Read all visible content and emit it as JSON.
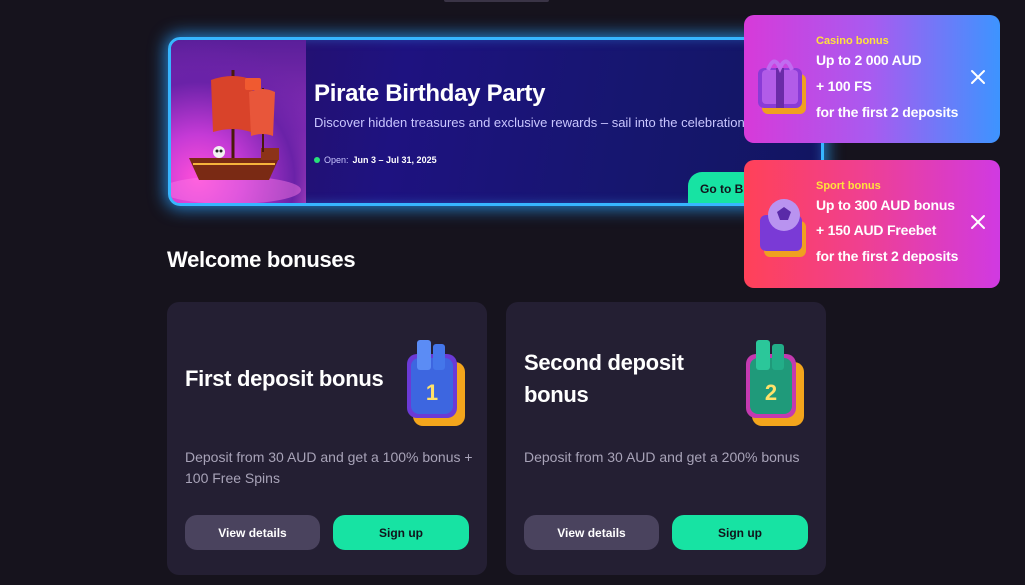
{
  "promo": {
    "title": "Pirate Birthday Party",
    "description": "Discover hidden treasures and exclusive rewards – sail into the celebration!",
    "open_label": "Open:",
    "dates": "Jun 3 – Jul 31, 2025",
    "cta_label": "Go to Birt"
  },
  "toasts": [
    {
      "kicker": "Casino bonus",
      "lines": [
        "Up to 2 000 AUD",
        "+ 100 FS",
        "for the first 2 deposits"
      ]
    },
    {
      "kicker": "Sport bonus",
      "lines": [
        "Up to 300 AUD bonus",
        "+ 150 AUD Freebet",
        "for the first 2 deposits"
      ]
    }
  ],
  "welcome": {
    "heading": "Welcome bonuses",
    "cards": [
      {
        "title": "First deposit bonus",
        "badge_number": "1",
        "description": "Deposit from 30 AUD and get a 100% bonus + 100 Free Spins",
        "details_label": "View details",
        "signup_label": "Sign up"
      },
      {
        "title": "Second deposit bonus",
        "badge_number": "2",
        "description": "Deposit from 30 AUD and get a 200% bonus",
        "details_label": "View details",
        "signup_label": "Sign up"
      }
    ]
  },
  "colors": {
    "background": "#16131d",
    "card": "#241f33",
    "accent_green": "#17e3a3",
    "banner_border": "#37b6ff",
    "kicker_yellow": "#ffe23c"
  },
  "icons": [
    "pirate-ship-icon",
    "gift-box-icon",
    "soccer-gift-icon",
    "close-icon",
    "deposit-badge-1-icon",
    "deposit-badge-2-icon",
    "status-dot-icon"
  ]
}
